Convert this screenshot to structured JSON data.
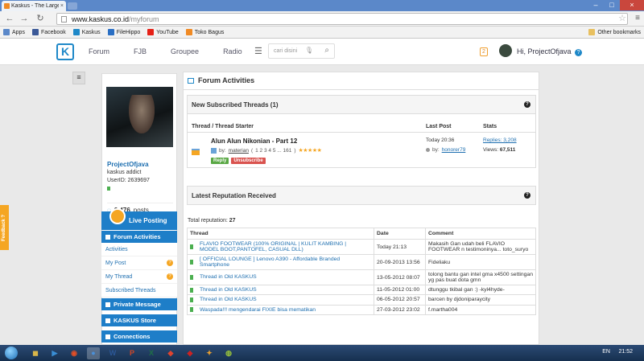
{
  "browser": {
    "tab_title": "Kaskus - The Largest Indo",
    "tab_close": "×",
    "url_host": "www.kaskus.co.id",
    "url_path": "/myforum",
    "bookmarks": [
      {
        "label": "Apps",
        "color": "#5b88c9"
      },
      {
        "label": "Facebook",
        "color": "#3b5998"
      },
      {
        "label": "Kaskus",
        "color": "#1e88c8"
      },
      {
        "label": "FileHippo",
        "color": "#2a6fc4"
      },
      {
        "label": "YouTube",
        "color": "#e62117"
      },
      {
        "label": "Toko Bagus",
        "color": "#f08a24"
      }
    ],
    "other_bookmarks": "Other bookmarks"
  },
  "header": {
    "logo": "K",
    "nav": [
      "Forum",
      "FJB",
      "Groupee",
      "Radio"
    ],
    "search_placeholder": "cari disini",
    "notifications": "2",
    "greeting": "Hi, ProjectOfjava",
    "help": "?"
  },
  "feedback_label": "Feedback ?",
  "profile": {
    "name": "ProjectOfjava",
    "rank": "kaskus addict",
    "user_id": "UserID: 2639697",
    "posts_count": "2,476",
    "posts_label": "posts"
  },
  "side_menu": {
    "live_posting": "Live Posting",
    "forum_activities": "Forum Activities",
    "sub_items": [
      {
        "label": "Activities",
        "badge": ""
      },
      {
        "label": "My Post",
        "badge": "?"
      },
      {
        "label": "My Thread",
        "badge": "?"
      },
      {
        "label": "Subscribed Threads",
        "badge": ""
      }
    ],
    "private_message": "Private Message",
    "kaskus_store": "KASKUS Store",
    "connections": "Connections"
  },
  "main": {
    "title": "Forum Activities",
    "subscribed": {
      "heading": "New Subscribed Threads (1)",
      "columns": [
        "Thread / Thread Starter",
        "Last Post",
        "Stats"
      ],
      "thread": {
        "title": "Alun Alun Nikonian - Part 12",
        "by": "by:",
        "starter": "materian",
        "pages": "1 2 3 4 5 ... 161",
        "stars": "★★★★★",
        "reply": "Reply",
        "unsubscribe": "Unsubscribe",
        "last_time": "Today 20:36",
        "last_by_label": "by:",
        "last_by": "honorer79",
        "replies": "Replies: 3,208",
        "views_label": "Views:",
        "views": "67,511"
      }
    },
    "reputation": {
      "heading": "Latest Reputation Received",
      "total_label": "Total reputation:",
      "total": "27",
      "columns": [
        "Thread",
        "Date",
        "Comment"
      ],
      "rows": [
        {
          "thread": "FLAVIO FOOTWEAR (100% ORIGINAL | KULIT KAMBING | MODEL BOOT,PANTOFEL, CASUAL DLL)",
          "date": "Today 21:13",
          "comment": "Makasih Gan udah beli FLAVIO FOOTWEAR n testimoninya... toto_suryo"
        },
        {
          "thread": "[ OFFICIAL LOUNGE ] Lenovo A390 - Affordable Branded Smartphone",
          "date": "20-09-2013 13:56",
          "comment": "Fideliaku"
        },
        {
          "thread": "Thread in Old KASKUS",
          "date": "13-05-2012 08:07",
          "comment": "tolong bantu gan intel gma x4500 settingan yg pas buat dota gmn"
        },
        {
          "thread": "Thread in Old KASKUS",
          "date": "11-05-2012 01:00",
          "comment": "dtunggu tkibal gan :) -kyl4hyde-"
        },
        {
          "thread": "Thread in Old KASKUS",
          "date": "06-05-2012 20:57",
          "comment": "barcen by djdoniparaycity"
        },
        {
          "thread": "Waspada!!! mengendarai FIXIE bisa mematikan",
          "date": "27-03-2012 23:02",
          "comment": "f.martha004"
        }
      ]
    }
  },
  "taskbar": {
    "apps": [
      {
        "glyph": "◼",
        "color": "#d8b64a"
      },
      {
        "glyph": "▶",
        "color": "#3a8fd6"
      },
      {
        "glyph": "◉",
        "color": "#e34f26"
      },
      {
        "glyph": "●",
        "color": "#4a90d9"
      },
      {
        "glyph": "W",
        "color": "#2b5797"
      },
      {
        "glyph": "P",
        "color": "#d24726"
      },
      {
        "glyph": "X",
        "color": "#1e7145"
      },
      {
        "glyph": "◆",
        "color": "#e0442f"
      },
      {
        "glyph": "◆",
        "color": "#c22"
      },
      {
        "glyph": "✦",
        "color": "#e8a030"
      },
      {
        "glyph": "◍",
        "color": "#9ac43a"
      }
    ],
    "lang": "EN",
    "clock": "21:52"
  }
}
